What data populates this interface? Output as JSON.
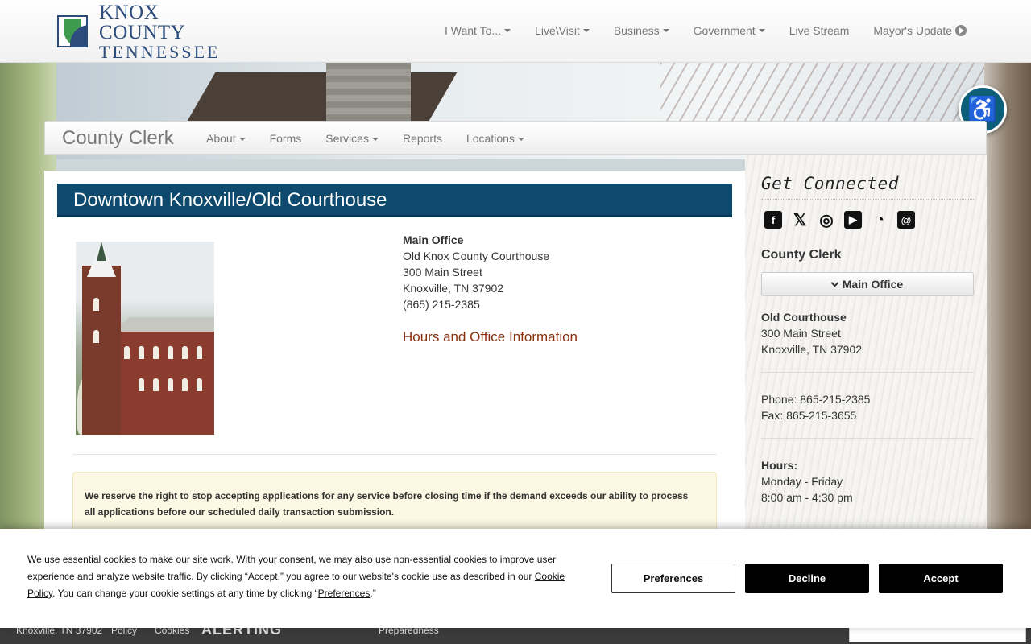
{
  "header": {
    "logo_line1": "KNOX COUNTY",
    "logo_line2": "TENNESSEE",
    "nav": [
      {
        "label": "I Want To...",
        "dropdown": true
      },
      {
        "label": "Live\\Visit",
        "dropdown": true
      },
      {
        "label": "Business",
        "dropdown": true
      },
      {
        "label": "Government",
        "dropdown": true
      },
      {
        "label": "Live Stream",
        "dropdown": false
      },
      {
        "label": "Mayor's Update",
        "dropdown": false
      }
    ]
  },
  "accessibility": {
    "icon": "wheelchair-icon",
    "glyph": "♿"
  },
  "subnav": {
    "brand": "County Clerk",
    "links": [
      {
        "label": "About",
        "dropdown": true
      },
      {
        "label": "Forms",
        "dropdown": false
      },
      {
        "label": "Services",
        "dropdown": true
      },
      {
        "label": "Reports",
        "dropdown": false
      },
      {
        "label": "Locations",
        "dropdown": true
      }
    ]
  },
  "main": {
    "title": "Downtown Knoxville/Old Courthouse",
    "office": {
      "heading": "Main Office",
      "name": "Old Knox County Courthouse",
      "street": "300 Main Street",
      "city": "Knoxville, TN 37902",
      "phone": "(865) 215-2385",
      "hours_link": "Hours and Office Information"
    },
    "alert_line1": "We reserve the right to stop accepting applications for any service before closing time if the demand exceeds our ability to process",
    "alert_line2": "all applications before our scheduled daily transaction submission."
  },
  "sidebar": {
    "get_connected": "Get Connected",
    "social": [
      {
        "icon": "facebook-icon",
        "glyph": "f",
        "style": "box"
      },
      {
        "icon": "x-icon",
        "glyph": "𝕏",
        "style": "plain"
      },
      {
        "icon": "instagram-icon",
        "glyph": "◎",
        "style": "plain"
      },
      {
        "icon": "youtube-icon",
        "glyph": "▶",
        "style": "box"
      },
      {
        "icon": "rss-icon",
        "glyph": "◔",
        "style": "plain"
      },
      {
        "icon": "email-icon",
        "glyph": "@",
        "style": "box"
      }
    ],
    "heading": "County Clerk",
    "dropdown_label": "Main Office",
    "location_name": "Old Courthouse",
    "street": "300 Main Street",
    "city": "Knoxville, TN 37902",
    "phone": "Phone: 865-215-2385",
    "fax": "Fax: 865-215-3655",
    "hours_label": "Hours:",
    "hours_days": "Monday - Friday",
    "hours_time": "8:00 am - 4:30 pm"
  },
  "footer": {
    "address": "Knoxville, TN 37902",
    "policy": "Policy",
    "cookies": "Cookies",
    "alerting": "ALERTING",
    "preparedness": "Preparedness"
  },
  "cookie": {
    "text_part1": "We use essential cookies to make our site work. With your consent, we may also use non-essential cookies to improve user experience and analyze website traffic. By clicking “Accept,” you agree to our website's cookie use as described in our ",
    "policy_link": "Cookie Policy",
    "text_part2": ". You can change your cookie settings at any time by clicking “",
    "preferences_link": "Preferences",
    "text_part3": ".”",
    "preferences_button": "Preferences",
    "decline_button": "Decline",
    "accept_button": "Accept"
  }
}
